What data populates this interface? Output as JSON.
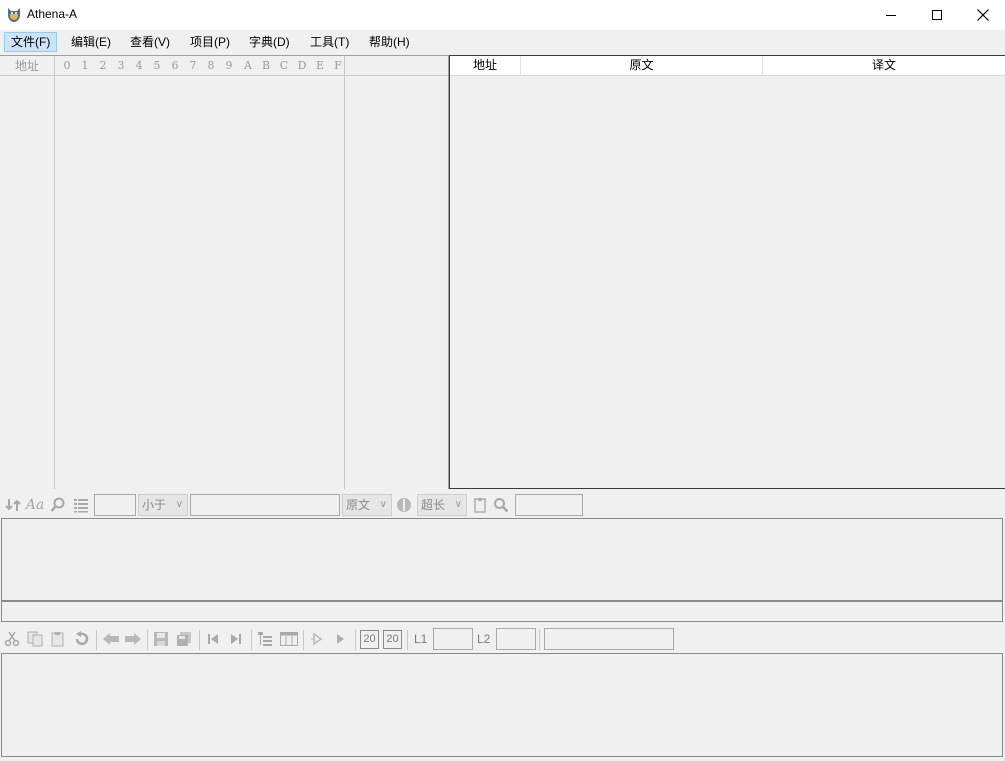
{
  "window": {
    "title": "Athena-A",
    "minimize_icon": "minimize-icon",
    "maximize_icon": "maximize-icon",
    "close_icon": "close-icon"
  },
  "menu": {
    "items": [
      {
        "label": "文件(F)"
      },
      {
        "label": "编辑(E)"
      },
      {
        "label": "查看(V)"
      },
      {
        "label": "项目(P)"
      },
      {
        "label": "字典(D)"
      },
      {
        "label": "工具(T)"
      },
      {
        "label": "帮助(H)"
      }
    ],
    "active_index": 0
  },
  "hex_view": {
    "address_header": "地址",
    "digits": [
      "0",
      "1",
      "2",
      "3",
      "4",
      "5",
      "6",
      "7",
      "8",
      "9",
      "A",
      "B",
      "C",
      "D",
      "E",
      "F"
    ]
  },
  "string_list": {
    "columns": [
      "地址",
      "原文",
      "译文"
    ]
  },
  "filter_toolbar": {
    "compare_value": "小于",
    "text_type": "原文",
    "length_filter": "超长"
  },
  "edit_toolbar": {
    "tag_a": "20",
    "tag_b": "20",
    "l1_label": "L1",
    "l2_label": "L2"
  },
  "colors": {
    "menu_highlight": "#cce4f7",
    "disabled_icon": "#a8a8a8"
  }
}
